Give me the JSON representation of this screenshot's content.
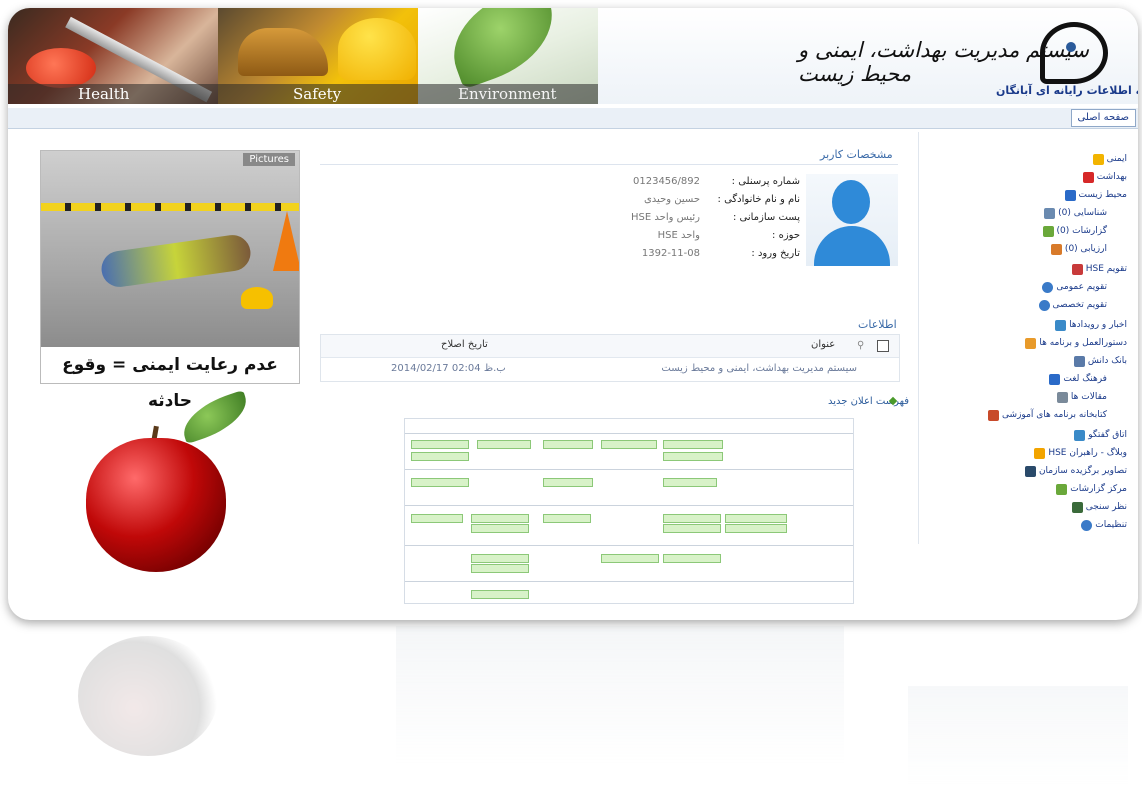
{
  "banner": {
    "segments": [
      "Health",
      "Safety",
      "Environment"
    ],
    "system_title": "سیستم مدیریت بهداشت، ایمنی و محیط زیست",
    "company": "موسسه اطلاعات رایانه ای آبانگان"
  },
  "nav": {
    "home": "صفحه اصلی"
  },
  "poster": {
    "tag": "Pictures",
    "caption": "عدم رعایت ایمنی = وقوع حادثه"
  },
  "user": {
    "title": "مشخصات کاربر",
    "rows": [
      {
        "label": "شماره پرسنلی :",
        "value": "0123456/892"
      },
      {
        "label": "نام و نام خانوادگی :",
        "value": "حسین وحیدی"
      },
      {
        "label": "پست سازمانی :",
        "value": "رئیس واحد HSE"
      },
      {
        "label": "حوزه :",
        "value": "واحد HSE"
      },
      {
        "label": "تاریخ ورود :",
        "value": "1392-11-08"
      }
    ]
  },
  "announcements": {
    "title": "اطلاعات",
    "col_title": "عنوان",
    "col_date": "تاریخ اصلاح",
    "row_title": "سیستم مدیریت بهداشت، ایمنی و محیط زیست",
    "row_date": "ب.ظ 02:04 2014/02/17",
    "more": "فهرست اعلان جدید"
  },
  "sidebar": {
    "items": [
      {
        "label": "ایمنی",
        "icon": "warning-icon",
        "color": "#f2b400"
      },
      {
        "label": "بهداشت",
        "icon": "first-aid-icon",
        "color": "#d62828"
      },
      {
        "label": "محیط زیست",
        "icon": "globe-icon",
        "color": "#2a6ac8"
      },
      {
        "label": "شناسایی (0)",
        "icon": "search-icon",
        "color": "#6a8ab0",
        "level": 1
      },
      {
        "label": "گزارشات (0)",
        "icon": "chart-icon",
        "color": "#6aa83a",
        "level": 1
      },
      {
        "label": "ارزیابی (0)",
        "icon": "hand-icon",
        "color": "#d87a2a",
        "level": 1
      },
      {
        "label": "تقویم HSE",
        "icon": "calendar-icon",
        "color": "#c83a3a"
      },
      {
        "label": "تقویم عمومی",
        "icon": "arrow-icon",
        "color": "#3a7ac8",
        "level": 1
      },
      {
        "label": "تقویم تخصصی",
        "icon": "arrow-icon",
        "color": "#3a7ac8",
        "level": 1
      },
      {
        "label": "اخبار و رویدادها",
        "icon": "news-icon",
        "color": "#3a8ac8"
      },
      {
        "label": "دستورالعمل و برنامه ها",
        "icon": "book-icon",
        "color": "#e89a2a"
      },
      {
        "label": "بانک دانش",
        "icon": "database-icon",
        "color": "#5a7aa8"
      },
      {
        "label": "فرهنگ لغت",
        "icon": "dictionary-icon",
        "color": "#2a6ac8",
        "level": 1
      },
      {
        "label": "مقالات ها",
        "icon": "article-icon",
        "color": "#7a8a9a",
        "level": 1
      },
      {
        "label": "کتابخانه برنامه های آموزشی",
        "icon": "library-icon",
        "color": "#c84a2a",
        "level": 1
      },
      {
        "label": "اتاق گفتگو",
        "icon": "chat-icon",
        "color": "#3a8ac8"
      },
      {
        "label": "وبلاگ - راهبران HSE",
        "icon": "blog-icon",
        "color": "#f2a400"
      },
      {
        "label": "تصاویر برگزیده سازمان",
        "icon": "camera-icon",
        "color": "#2a4a6a"
      },
      {
        "label": "مرکز گزارشات",
        "icon": "report-icon",
        "color": "#6aa83a"
      },
      {
        "label": "نظر سنجی",
        "icon": "vote-icon",
        "color": "#3a6a3a"
      },
      {
        "label": "تنظیمات",
        "icon": "gear-icon",
        "color": "#3a7ac8"
      }
    ]
  }
}
